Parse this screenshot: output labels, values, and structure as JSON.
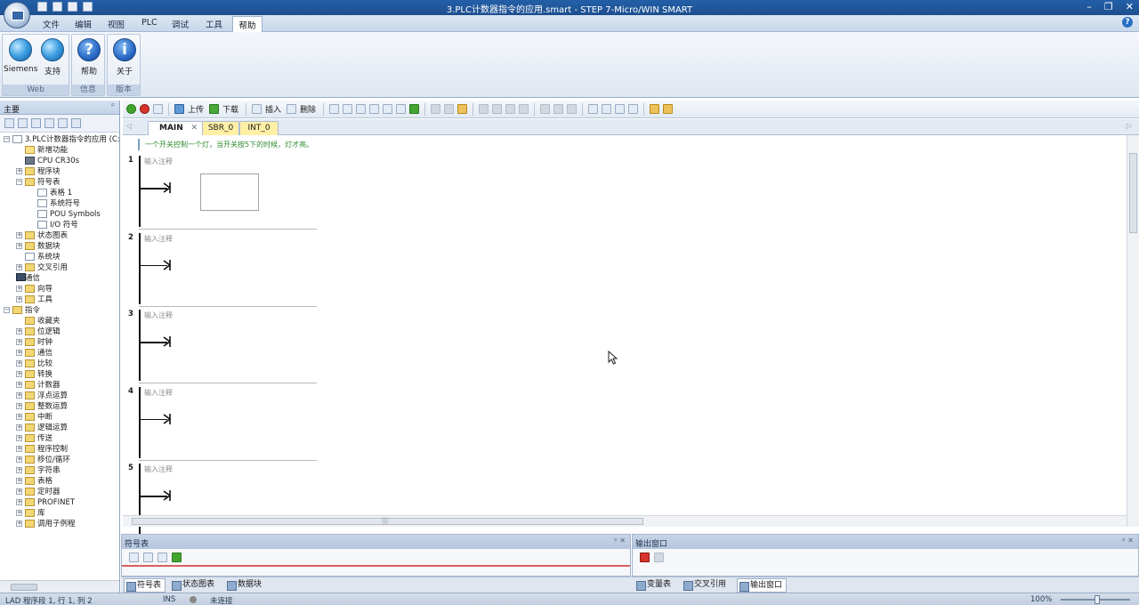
{
  "window": {
    "title": "3.PLC计数器指令的应用.smart - STEP 7-Micro/WIN SMART",
    "controls": [
      "–",
      "❐",
      "✕"
    ]
  },
  "menu": {
    "items": [
      "文件",
      "编辑",
      "视图",
      "PLC",
      "调试",
      "工具"
    ],
    "active": "帮助",
    "help_icon": "?"
  },
  "ribbon": {
    "groups": [
      {
        "label": "Web",
        "buttons": [
          {
            "label": "Siemens",
            "icon": "globe-icon"
          },
          {
            "label": "支持",
            "icon": "globe-support-icon"
          }
        ]
      },
      {
        "label": "信息",
        "buttons": [
          {
            "label": "帮助",
            "icon": "help-icon"
          }
        ]
      },
      {
        "label": "版本",
        "buttons": [
          {
            "label": "关于",
            "icon": "info-icon"
          }
        ]
      }
    ]
  },
  "left_panel": {
    "title": "主要",
    "pin": "ᵖ",
    "tree": [
      {
        "label": "3.PLC计数器指令的应用 (C:\\",
        "level": 0,
        "exp": "⊟",
        "icon": "doc"
      },
      {
        "label": "新增功能",
        "level": 1,
        "exp": "",
        "icon": "star"
      },
      {
        "label": "CPU CR30s",
        "level": 1,
        "exp": "",
        "icon": "cpu"
      },
      {
        "label": "程序块",
        "level": 1,
        "exp": "⊞",
        "icon": "folder"
      },
      {
        "label": "符号表",
        "level": 1,
        "exp": "⊟",
        "icon": "folder"
      },
      {
        "label": "表格 1",
        "level": 2,
        "exp": "",
        "icon": "doc"
      },
      {
        "label": "系统符号",
        "level": 2,
        "exp": "",
        "icon": "doc"
      },
      {
        "label": "POU Symbols",
        "level": 2,
        "exp": "",
        "icon": "doc"
      },
      {
        "label": "I/O 符号",
        "level": 2,
        "exp": "",
        "icon": "doc"
      },
      {
        "label": "状态图表",
        "level": 1,
        "exp": "⊞",
        "icon": "folder"
      },
      {
        "label": "数据块",
        "level": 1,
        "exp": "⊞",
        "icon": "folder"
      },
      {
        "label": "系统块",
        "level": 1,
        "exp": "",
        "icon": "doc"
      },
      {
        "label": "交叉引用",
        "level": 1,
        "exp": "⊞",
        "icon": "folder"
      },
      {
        "label": "通信",
        "level": 1,
        "exp": "",
        "icon": "net"
      },
      {
        "label": "向导",
        "level": 1,
        "exp": "⊞",
        "icon": "folder"
      },
      {
        "label": "工具",
        "level": 1,
        "exp": "⊞",
        "icon": "folder"
      },
      {
        "label": "指令",
        "level": 0,
        "exp": "⊟",
        "icon": "folder"
      },
      {
        "label": "收藏夹",
        "level": 1,
        "exp": "",
        "icon": "folder"
      },
      {
        "label": "位逻辑",
        "level": 1,
        "exp": "⊞",
        "icon": "folder"
      },
      {
        "label": "时钟",
        "level": 1,
        "exp": "⊞",
        "icon": "folder"
      },
      {
        "label": "通信",
        "level": 1,
        "exp": "⊞",
        "icon": "folder"
      },
      {
        "label": "比较",
        "level": 1,
        "exp": "⊞",
        "icon": "folder"
      },
      {
        "label": "转换",
        "level": 1,
        "exp": "⊞",
        "icon": "folder"
      },
      {
        "label": "计数器",
        "level": 1,
        "exp": "⊞",
        "icon": "folder"
      },
      {
        "label": "浮点运算",
        "level": 1,
        "exp": "⊞",
        "icon": "folder"
      },
      {
        "label": "整数运算",
        "level": 1,
        "exp": "⊞",
        "icon": "folder"
      },
      {
        "label": "中断",
        "level": 1,
        "exp": "⊞",
        "icon": "folder"
      },
      {
        "label": "逻辑运算",
        "level": 1,
        "exp": "⊞",
        "icon": "folder"
      },
      {
        "label": "传送",
        "level": 1,
        "exp": "⊞",
        "icon": "folder"
      },
      {
        "label": "程序控制",
        "level": 1,
        "exp": "⊞",
        "icon": "folder"
      },
      {
        "label": "移位/循环",
        "level": 1,
        "exp": "⊞",
        "icon": "folder"
      },
      {
        "label": "字符串",
        "level": 1,
        "exp": "⊞",
        "icon": "folder"
      },
      {
        "label": "表格",
        "level": 1,
        "exp": "⊞",
        "icon": "folder"
      },
      {
        "label": "定时器",
        "level": 1,
        "exp": "⊞",
        "icon": "folder"
      },
      {
        "label": "PROFINET",
        "level": 1,
        "exp": "⊞",
        "icon": "folder"
      },
      {
        "label": "库",
        "level": 1,
        "exp": "⊞",
        "icon": "folder"
      },
      {
        "label": "调用子例程",
        "level": 1,
        "exp": "⊞",
        "icon": "folder"
      }
    ]
  },
  "toolbar": {
    "upload": "上传",
    "download": "下载",
    "insert": "插入",
    "delete": "删除"
  },
  "tabs": [
    {
      "label": "MAIN",
      "close": "✕"
    },
    {
      "label": "SBR_0"
    },
    {
      "label": "INT_0"
    }
  ],
  "editor": {
    "program_comment": "一个开关控制一个灯，当开关按5下的时候，灯才亮。",
    "networks": [
      {
        "num": "1",
        "comment": "输入注释"
      },
      {
        "num": "2",
        "comment": "输入注释"
      },
      {
        "num": "3",
        "comment": "输入注释"
      },
      {
        "num": "4",
        "comment": "输入注释"
      },
      {
        "num": "5",
        "comment": "输入注释"
      }
    ],
    "hscroll_mark": "|||"
  },
  "bottom": {
    "symbol_panel_title": "符号表",
    "output_panel_title": "输出窗口",
    "left_tabs": [
      "符号表",
      "状态图表",
      "数据块"
    ],
    "right_tabs": [
      "变量表",
      "交叉引用",
      "输出窗口"
    ]
  },
  "status": {
    "position": "LAD 程序段 1, 行 1, 列 2",
    "mode": "INS",
    "connection": "未连接",
    "zoom": "100%"
  }
}
